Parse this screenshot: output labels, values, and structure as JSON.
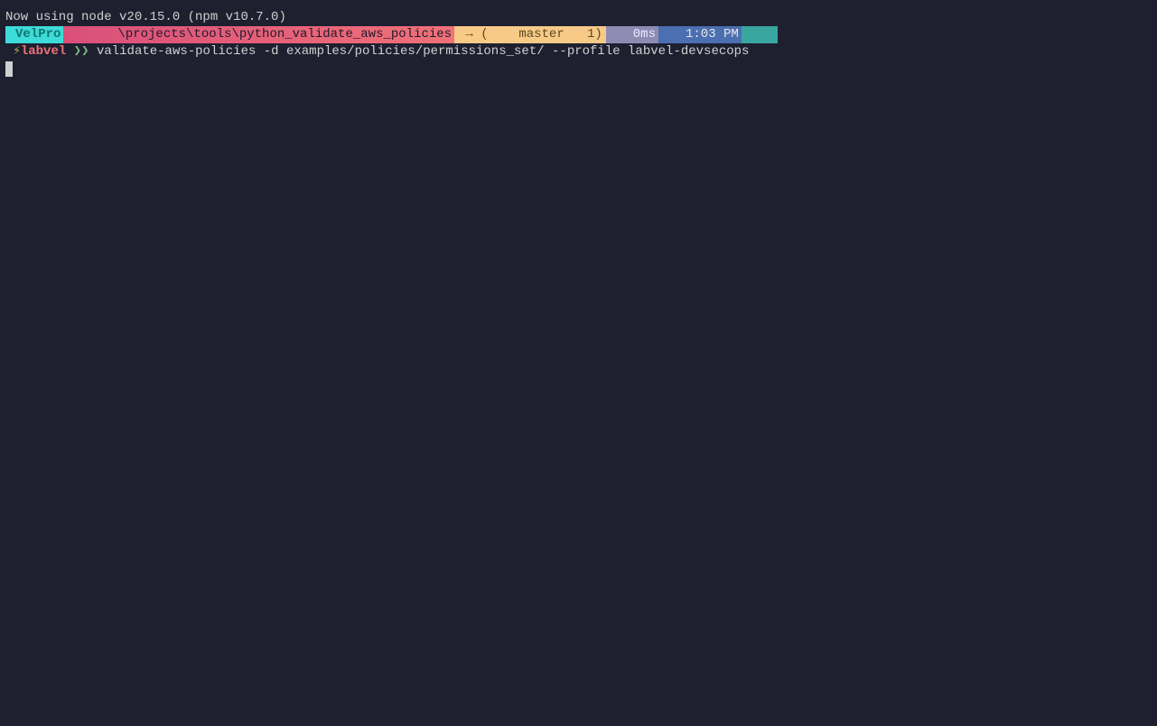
{
  "node_message": "Now using node v20.15.0 (npm v10.7.0)",
  "status": {
    "host": "VelPro",
    "path": "\\projects\\tools\\python_validate_aws_policies",
    "branch_prefix": " → (",
    "branch_name": "master",
    "branch_count": "1",
    "branch_suffix": ")",
    "duration": "0ms",
    "time": "1:03 PM"
  },
  "prompt": {
    "bolt": " ⚡",
    "user": "labvel",
    "arrows": " ❯❯ ",
    "command": "validate-aws-policies -d examples/policies/permissions_set/ --profile labvel-devsecops"
  }
}
